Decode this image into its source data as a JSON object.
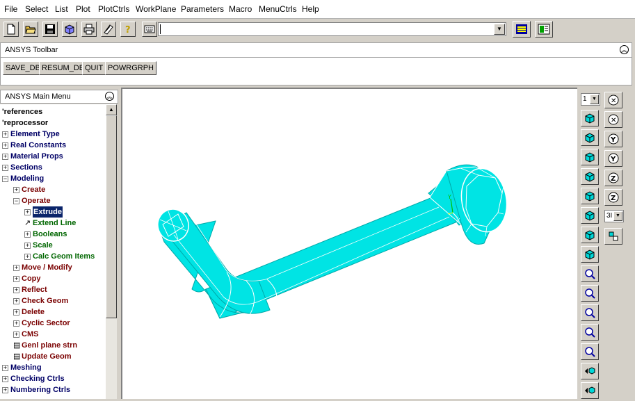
{
  "menubar": {
    "items": [
      {
        "label": "File",
        "key": "F"
      },
      {
        "label": "Select",
        "key": "S"
      },
      {
        "label": "List",
        "key": "L"
      },
      {
        "label": "Plot",
        "key": "P"
      },
      {
        "label": "PlotCtrls",
        "key": "C"
      },
      {
        "label": "WorkPlane",
        "key": "W"
      },
      {
        "label": "Parameters",
        "key": "a"
      },
      {
        "label": "Macro",
        "key": "M"
      },
      {
        "label": "MenuCtrls",
        "key": "n"
      },
      {
        "label": "Help",
        "key": "H"
      }
    ]
  },
  "toolbar": {
    "icons": [
      "new-file-icon",
      "open-folder-icon",
      "save-icon",
      "view-icon",
      "print-icon",
      "report-icon",
      "help-icon"
    ],
    "command_value": ""
  },
  "ansys_toolbar": {
    "title": "ANSYS Toolbar",
    "buttons": [
      "SAVE_DB",
      "RESUM_DB",
      "QUIT",
      "POWRGRPH"
    ]
  },
  "main_menu": {
    "title": "ANSYS Main Menu",
    "items": [
      {
        "label": "'references",
        "prefix": "",
        "color": "blk"
      },
      {
        "label": "'reprocessor",
        "prefix": "",
        "color": "blk"
      },
      {
        "label": "Element Type",
        "prefix": "+",
        "color": "nav"
      },
      {
        "label": "Real Constants",
        "prefix": "+",
        "color": "nav"
      },
      {
        "label": "Material Props",
        "prefix": "+",
        "color": "nav"
      },
      {
        "label": "Sections",
        "prefix": "+",
        "color": "nav"
      },
      {
        "label": "Modeling",
        "prefix": "−",
        "color": "nav"
      },
      {
        "label": "Create",
        "prefix": "+",
        "color": "red"
      },
      {
        "label": "Operate",
        "prefix": "−",
        "color": "red"
      },
      {
        "label": "Extrude",
        "prefix": "+",
        "color": "grn",
        "selected": true
      },
      {
        "label": "Extend Line",
        "prefix": "↗",
        "color": "grn"
      },
      {
        "label": "Booleans",
        "prefix": "+",
        "color": "grn"
      },
      {
        "label": "Scale",
        "prefix": "+",
        "color": "grn"
      },
      {
        "label": "Calc Geom Items",
        "prefix": "+",
        "color": "grn"
      },
      {
        "label": "Move / Modify",
        "prefix": "+",
        "color": "red"
      },
      {
        "label": "Copy",
        "prefix": "+",
        "color": "red"
      },
      {
        "label": "Reflect",
        "prefix": "+",
        "color": "red"
      },
      {
        "label": "Check Geom",
        "prefix": "+",
        "color": "red"
      },
      {
        "label": "Delete",
        "prefix": "+",
        "color": "red"
      },
      {
        "label": "Cyclic Sector",
        "prefix": "+",
        "color": "red"
      },
      {
        "label": "CMS",
        "prefix": "+",
        "color": "red"
      },
      {
        "label": "Genl plane strn",
        "prefix": "▤",
        "color": "red"
      },
      {
        "label": "Update Geom",
        "prefix": "▤",
        "color": "red"
      },
      {
        "label": "Meshing",
        "prefix": "+",
        "color": "nav"
      },
      {
        "label": "Checking Ctrls",
        "prefix": "+",
        "color": "nav"
      },
      {
        "label": "Numbering Ctrls",
        "prefix": "+",
        "color": "nav"
      }
    ]
  },
  "right_panel": {
    "window_select": "1",
    "view_select": "3I",
    "icons": [
      "iso-view-icon",
      "oblique-view-icon",
      "front-view-icon",
      "top-view-icon",
      "back-view-icon",
      "bottom-view-icon",
      "left-view-icon",
      "right-view-icon",
      "zoom-window-icon",
      "zoom-icon",
      "back-up-icon",
      "zoom-in-icon",
      "zoom-out-icon",
      "pan-left-icon",
      "pan-right-icon",
      "rotate-x-pos-icon",
      "rotate-x-neg-icon",
      "rotate-y-pos-icon",
      "rotate-y-neg-icon",
      "rotate-z-pos-icon",
      "rotate-z-neg-icon",
      "dynamic-mode-icon"
    ]
  },
  "colors": {
    "model_fill": "#00e0e0",
    "model_line": "#ffffff",
    "selection": "#0a246a"
  }
}
